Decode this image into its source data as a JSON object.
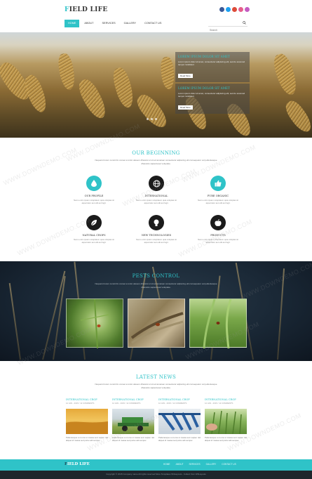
{
  "brand": {
    "logo_first": "F",
    "logo_rest": "IELD LIFE"
  },
  "social": [
    {
      "icon": "facebook-icon",
      "color": "#3b5998"
    },
    {
      "icon": "twitter-icon",
      "color": "#1da1f2"
    },
    {
      "icon": "google-plus-icon",
      "color": "#dd4b39"
    },
    {
      "icon": "pinterest-icon",
      "color": "#e55e8c"
    },
    {
      "icon": "dribbble-icon",
      "color": "#c45cc2"
    }
  ],
  "nav": [
    {
      "label": "HOME",
      "active": true
    },
    {
      "label": "ABOUT",
      "active": false
    },
    {
      "label": "SERVICES",
      "active": false
    },
    {
      "label": "GALLERY",
      "active": false
    },
    {
      "label": "CONTACT US",
      "active": false
    }
  ],
  "search": {
    "placeholder": "Search"
  },
  "hero": {
    "boxes": [
      {
        "title": "Lorem ipsum dolor sit amet",
        "text": "Lorem ipsum dolor sit amet, consectetur adipiscing elit, sed do eiusmod tempor incididunt",
        "button": "Read More"
      },
      {
        "title": "Lorem ipsum dolor sit amet",
        "text": "Lorem ipsum dolor sit amet, consectetur adipiscing elit, sed do eiusmod tempor incididunt",
        "button": "Read More"
      }
    ]
  },
  "beginning": {
    "title": "OUR BEGINNING",
    "text": "Nequerst lorem consit ilm conset a tortor alusem dharelot ut sit ed ametsen consectetur adpiscing elit consequetur vel pellentesque dharelots sapienteset voluptate.",
    "features": [
      {
        "title": "OUR PROFILE",
        "icon": "drop-icon",
        "text": "Nemo enim ipsam voluptatem quia voluptas sit aspernatur aut odit aut fugit."
      },
      {
        "title": "INTERNATIONAL",
        "icon": "globe-icon",
        "text": "Nemo enim ipsam voluptatem quia voluptas sit aspernatur aut odit aut fugit."
      },
      {
        "title": "PURE ORGANIC",
        "icon": "thumbs-up-icon",
        "text": "Nemo enim ipsam voluptatem quia voluptas sit aspernatur aut odit aut fugit."
      },
      {
        "title": "NATURAL CROPS",
        "icon": "leaf-icon",
        "text": "Nemo enim ipsam voluptatem quia voluptas sit aspernatur aut odit aut fugit."
      },
      {
        "title": "NEW TECHNOLOGIES",
        "icon": "lightbulb-icon",
        "text": "Nemo enim ipsam voluptatem quia voluptas sit aspernatur aut odit aut fugit."
      },
      {
        "title": "PRODUCTS",
        "icon": "apple-icon",
        "text": "Nemo enim ipsam voluptatem quia voluptas sit aspernatur aut odit aut fugit."
      }
    ]
  },
  "pests": {
    "title": "PESTS CONTROL",
    "text": "Nequerst lorem consit ilm conset a tortor alusem dharelot ut sit ed ametsen consectetur adpiscing elit consequetur vel pellentesque dharelots sapienteset voluptate."
  },
  "news": {
    "title": "LATEST NEWS",
    "text": "Nequerst lorem consit ilm conset a tortor alusem dharelot ut sit ed ametsen consectetur adpiscing elit consequetur vel pellentesque dharelots sapienteset voluptate.",
    "items": [
      {
        "title": "INTERNATIONAL CROP",
        "date": "12 JAN - 2015 / 12 COMMENTS",
        "text": "Pellentesque a ut eros ut massa sem sapien nisl aliquet id massa sed porta velit semper."
      },
      {
        "title": "INTERNATIONAL CROP",
        "date": "12 JAN - 2015 / 12 COMMENTS",
        "text": "Pellentesque a ut eros ut massa sem sapien nisl aliquet id massa sed porta velit semper."
      },
      {
        "title": "INTERNATIONAL CROP",
        "date": "12 JAN - 2015 / 12 COMMENTS",
        "text": "Pellentesque a ut eros ut massa sem sapien nisl aliquet id massa sed porta velit semper."
      },
      {
        "title": "INTERNATIONAL CROP",
        "date": "12 JAN - 2015 / 12 COMMENTS",
        "text": "Pellentesque a ut eros ut massa sem sapien nisl aliquet id massa sed porta velit semper."
      }
    ]
  },
  "footer": {
    "logo_first": "F",
    "logo_rest": "IELD LIFE",
    "nav": [
      "HOME",
      "ABOUT",
      "SERVICES",
      "GALLERY",
      "CONTACT US"
    ],
    "copyright": "Copyright © 2015 Company name All rights reserved More Templates W3Layouts - Collect from W3Layouts"
  },
  "watermark": "WWW.DOWNDEMO.COM",
  "colors": {
    "accent": "#2fc3c8",
    "footer_dark": "#1e262c",
    "icon_dark": "#1b1b1b"
  }
}
